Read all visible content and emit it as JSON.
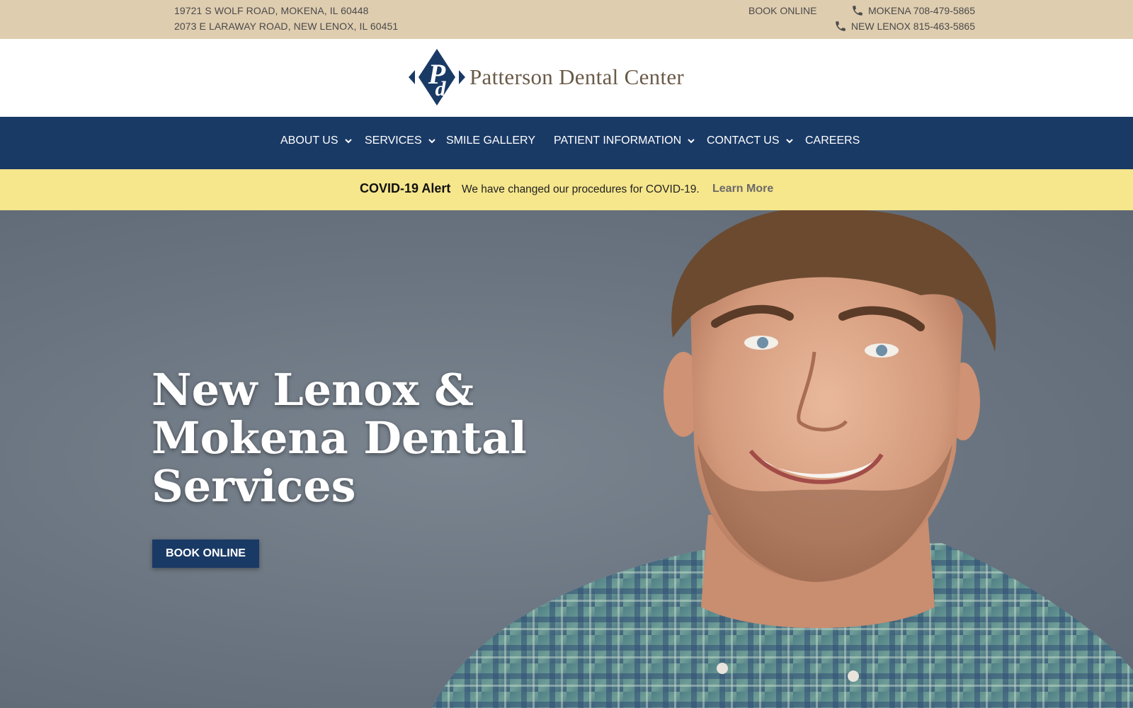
{
  "topbar": {
    "address_1": "19721 S WOLF ROAD, MOKENA, IL 60448",
    "address_2": "2073 E LARAWAY ROAD, NEW LENOX, IL 60451",
    "book_online": "BOOK ONLINE",
    "phone_1": "MOKENA 708-479-5865",
    "phone_2": "NEW LENOX 815-463-5865",
    "phone_icon": "phone-icon"
  },
  "logo": {
    "name": "Patterson Dental Center",
    "monogram": "Pd"
  },
  "nav": {
    "items": [
      {
        "label": "ABOUT US",
        "dropdown": true
      },
      {
        "label": "SERVICES",
        "dropdown": true
      },
      {
        "label": "SMILE GALLERY",
        "dropdown": false
      },
      {
        "label": "PATIENT INFORMATION",
        "dropdown": true
      },
      {
        "label": "CONTACT US",
        "dropdown": true
      },
      {
        "label": "CAREERS",
        "dropdown": false
      }
    ]
  },
  "alert": {
    "title": "COVID-19 Alert",
    "message": "We have changed our procedures for COVID-19.",
    "link": "Learn More"
  },
  "hero": {
    "title": "New Lenox & Mokena Dental Services",
    "button": "BOOK ONLINE"
  },
  "colors": {
    "topbar_bg": "#dfcdb0",
    "nav_bg": "#1a3a66",
    "alert_bg": "#f6e68c",
    "logo_text": "#6a5a48"
  }
}
